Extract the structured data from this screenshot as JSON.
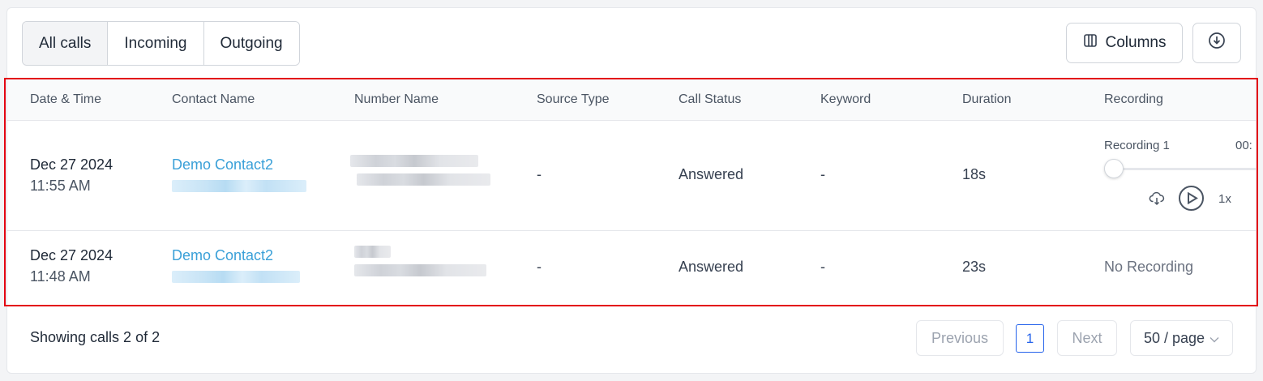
{
  "tabs": [
    {
      "label": "All calls",
      "active": true
    },
    {
      "label": "Incoming",
      "active": false
    },
    {
      "label": "Outgoing",
      "active": false
    }
  ],
  "toolbar": {
    "columns_label": "Columns",
    "columns_icon": "columns-icon",
    "download_icon": "download-circle-icon"
  },
  "table": {
    "headers": [
      "Date & Time",
      "Contact Name",
      "Number Name",
      "Source Type",
      "Call Status",
      "Keyword",
      "Duration",
      "Recording"
    ],
    "rows": [
      {
        "date": "Dec 27 2024",
        "time": "11:55 AM",
        "contact": "Demo Contact2",
        "source_type": "-",
        "call_status": "Answered",
        "keyword": "-",
        "duration": "18s",
        "recording": {
          "label": "Recording 1",
          "time": "00:",
          "speed": "1x",
          "progress": 0
        }
      },
      {
        "date": "Dec 27 2024",
        "time": "11:48 AM",
        "contact": "Demo Contact2",
        "source_type": "-",
        "call_status": "Answered",
        "keyword": "-",
        "duration": "23s",
        "recording_text": "No Recording"
      }
    ]
  },
  "footer": {
    "summary": "Showing calls 2 of 2",
    "previous": "Previous",
    "page": "1",
    "next": "Next",
    "page_size": "50 / page"
  },
  "colors": {
    "link": "#3aa0d8",
    "highlight": "#e30613",
    "active_page": "#2563eb"
  }
}
